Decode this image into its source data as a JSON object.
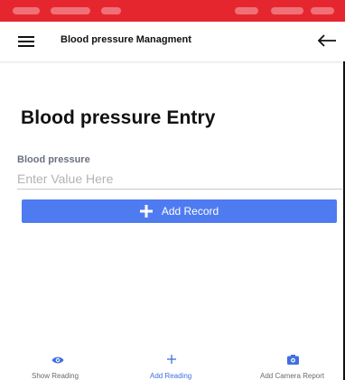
{
  "app_bar": {
    "title": "Blood pressure Managment"
  },
  "form": {
    "title": "Blood pressure Entry",
    "field_label": "Blood pressure",
    "field_placeholder": "Enter Value Here",
    "field_value": "",
    "submit_label": "Add Record"
  },
  "bottom_nav": {
    "tabs": [
      {
        "label": "Show Reading",
        "icon": "eye-icon",
        "active": false
      },
      {
        "label": "Add Reading",
        "icon": "plus-icon",
        "active": true
      },
      {
        "label": "Add Camera Report",
        "icon": "camera-icon",
        "active": false
      }
    ],
    "active_color": "#3f6fe0",
    "inactive_color": "#6b6b6b"
  },
  "colors": {
    "status_bar": "#e6262e",
    "primary_button": "#4f7bf0",
    "nav_icon": "#3f6fe0"
  }
}
